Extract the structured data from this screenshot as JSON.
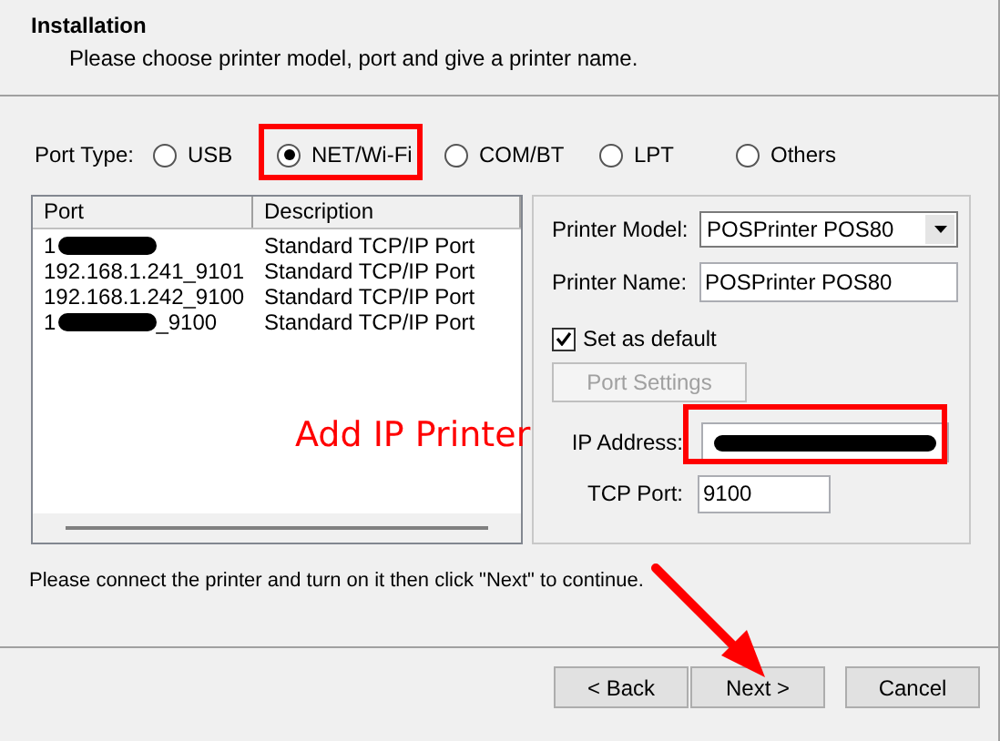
{
  "header": {
    "title": "Installation",
    "subtitle": "Please choose printer model, port and give a printer name."
  },
  "port_type": {
    "label": "Port Type:",
    "options": [
      {
        "label": "USB",
        "selected": false
      },
      {
        "label": "NET/Wi-Fi",
        "selected": true
      },
      {
        "label": "COM/BT",
        "selected": false
      },
      {
        "label": "LPT",
        "selected": false
      },
      {
        "label": "Others",
        "selected": false
      }
    ]
  },
  "port_list": {
    "columns": [
      "Port",
      "Description"
    ],
    "rows": [
      {
        "port": "1",
        "redacted": true,
        "description": "Standard TCP/IP Port"
      },
      {
        "port": "192.168.1.241_9101",
        "redacted": false,
        "description": "Standard TCP/IP Port"
      },
      {
        "port": "192.168.1.242_9100",
        "redacted": false,
        "description": "Standard TCP/IP Port"
      },
      {
        "port": "1",
        "redacted": true,
        "port_suffix": "_9100",
        "description": "Standard TCP/IP Port"
      }
    ]
  },
  "settings": {
    "model_label": "Printer Model:",
    "model_value": "POSPrinter POS80",
    "name_label": "Printer Name:",
    "name_value": "POSPrinter POS80",
    "default": {
      "label": "Set as default",
      "checked": true
    },
    "port_settings": {
      "label": "Port Settings",
      "disabled": true
    },
    "ip_label": "IP Address:",
    "ip_redacted": true,
    "tcp_label": "TCP Port:",
    "tcp_value": "9100"
  },
  "hint": "Please connect the printer and turn on it then click \"Next\" to continue.",
  "buttons": [
    {
      "label": "< Back"
    },
    {
      "label": "Next >"
    },
    {
      "label": "Cancel"
    }
  ],
  "annotation": {
    "text": "Add IP Printer"
  }
}
